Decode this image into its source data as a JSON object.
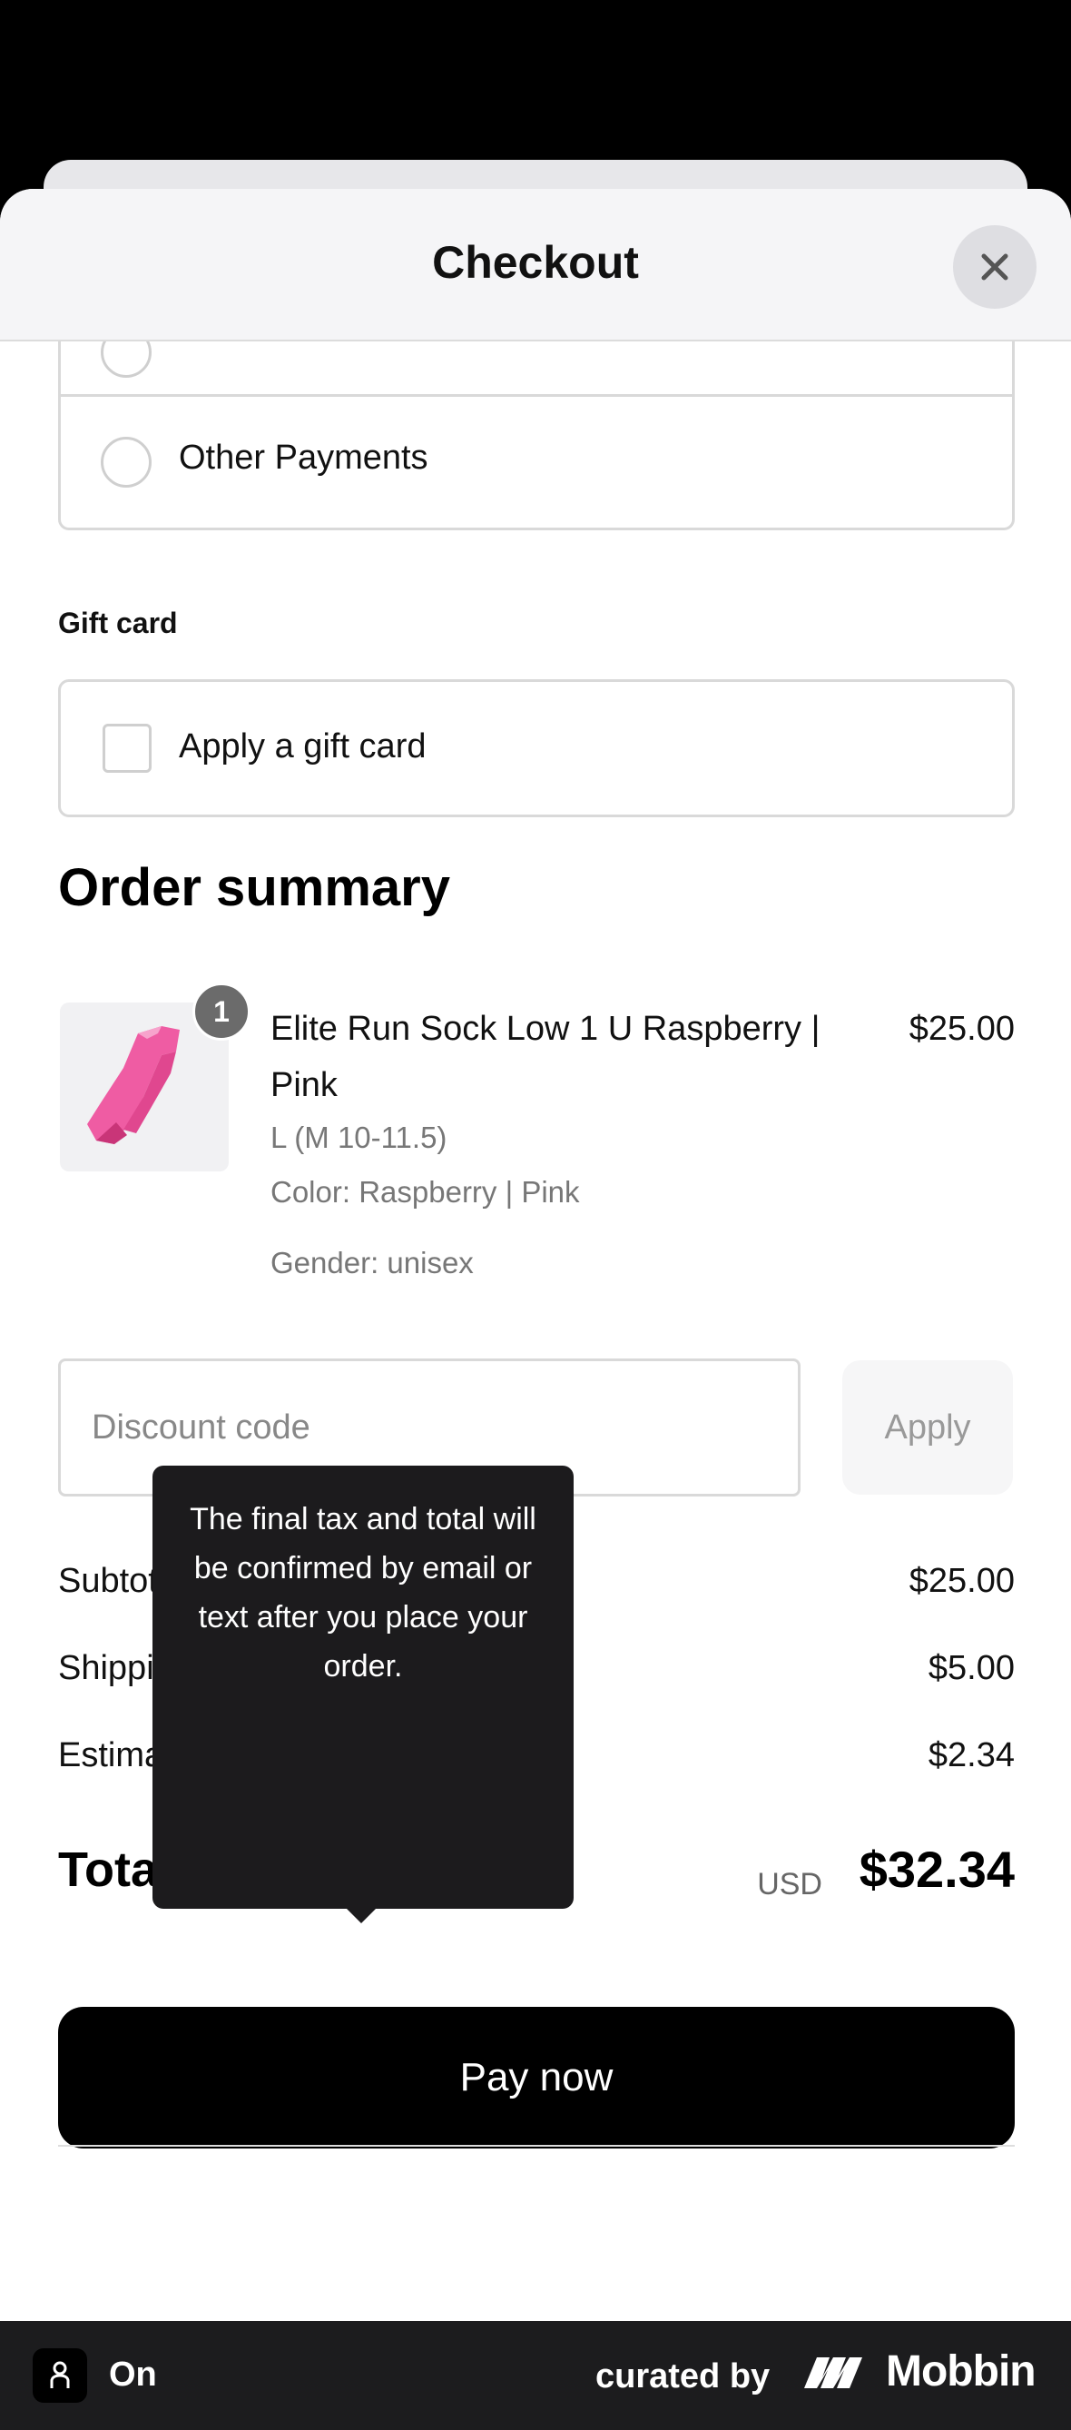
{
  "sheet": {
    "title": "Checkout"
  },
  "payment": {
    "other_label": "Other Payments"
  },
  "gift_card": {
    "section_label": "Gift card",
    "apply_label": "Apply a gift card"
  },
  "order_summary": {
    "title": "Order summary",
    "item": {
      "quantity": "1",
      "name": "Elite Run Sock Low 1 U Raspberry | Pink",
      "price": "$25.00",
      "size": "L (M 10-11.5)",
      "color": "Color: Raspberry | Pink",
      "gender": "Gender: unisex"
    }
  },
  "discount": {
    "placeholder": "Discount code",
    "apply_label": "Apply"
  },
  "totals": {
    "subtotal_label": "Subtotal",
    "subtotal_value": "$25.00",
    "shipping_label": "Shipping",
    "shipping_value": "$5.00",
    "taxes_label": "Estimated taxes",
    "taxes_value": "$2.34",
    "total_label": "Total",
    "currency": "USD",
    "total_value": "$32.34"
  },
  "tooltip": {
    "text": "The final tax and total will be confirmed by email or text after you place your order."
  },
  "actions": {
    "pay_label": "Pay now"
  },
  "footer": {
    "app_name": "On",
    "curated_by": "curated by",
    "brand": "Mobbin"
  },
  "icons": {
    "close": "close-icon",
    "help": "question-circle-icon"
  }
}
